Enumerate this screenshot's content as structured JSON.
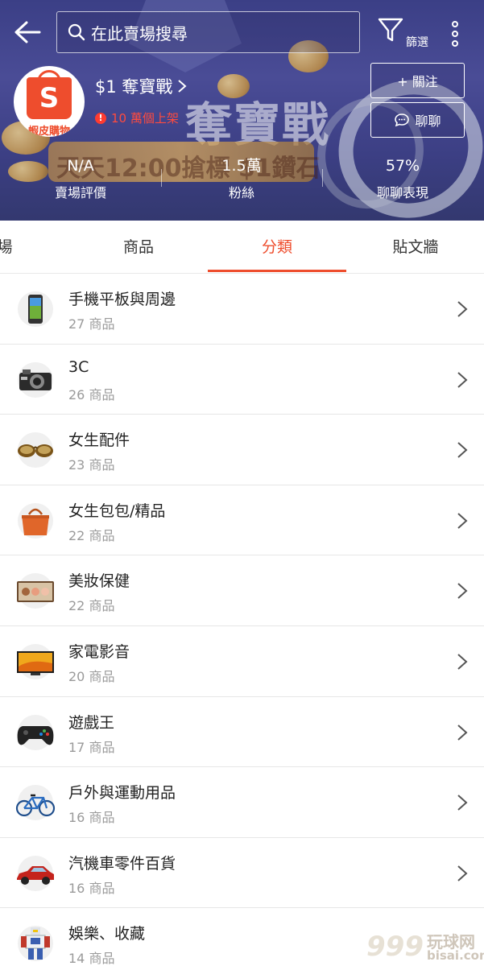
{
  "header": {
    "search_placeholder": "在此賣場搜尋",
    "filter_label": "篩選",
    "banner_big_text": "奪寶戰",
    "banner_ribbon_text": "天天12:00搶標 $1鑽石",
    "shop": {
      "avatar_label": "蝦皮購物",
      "name": "$1 奪寶戰",
      "subtitle": "10 萬個上架"
    },
    "follow_label": "+ 關注",
    "chat_label": "聊聊",
    "stats": [
      {
        "value": "N/A",
        "label": "賣場評價"
      },
      {
        "value": "1.5萬",
        "label": "粉絲"
      },
      {
        "value": "57%",
        "label": "聊聊表現"
      }
    ]
  },
  "tabs": [
    {
      "label": "場"
    },
    {
      "label": "商品"
    },
    {
      "label": "分類"
    },
    {
      "label": "貼文牆"
    }
  ],
  "active_tab": "分類",
  "categories": [
    {
      "name": "手機平板與周邊",
      "count": "27 商品",
      "icon": "smartphone-icon"
    },
    {
      "name": "3C",
      "count": "26 商品",
      "icon": "camera-icon"
    },
    {
      "name": "女生配件",
      "count": "23 商品",
      "icon": "sunglasses-icon"
    },
    {
      "name": "女生包包/精品",
      "count": "22 商品",
      "icon": "handbag-icon"
    },
    {
      "name": "美妝保健",
      "count": "22 商品",
      "icon": "eyeshadow-palette-icon"
    },
    {
      "name": "家電影音",
      "count": "20 商品",
      "icon": "television-icon"
    },
    {
      "name": "遊戲王",
      "count": "17 商品",
      "icon": "game-controller-icon"
    },
    {
      "name": "戶外與運動用品",
      "count": "16 商品",
      "icon": "bicycle-icon"
    },
    {
      "name": "汽機車零件百貨",
      "count": "16 商品",
      "icon": "car-icon"
    },
    {
      "name": "娛樂、收藏",
      "count": "14 商品",
      "icon": "robot-figure-icon"
    }
  ],
  "watermark": {
    "number": "999",
    "cn": "玩球网",
    "en": "bisai.com"
  },
  "colors": {
    "accent": "#ee4d2d",
    "banner": "#3b3f86",
    "muted_text": "#9a9a9a"
  }
}
